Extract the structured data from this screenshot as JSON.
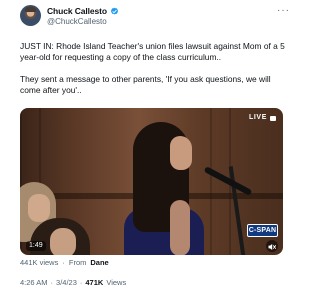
{
  "author": {
    "display_name": "Chuck Callesto",
    "handle": "@ChuckCallesto",
    "verified": true,
    "avatar_icon": "profile-photo"
  },
  "tweet": {
    "paragraphs": [
      "JUST IN: Rhode Island Teacher's union files lawsuit against Mom of a 5 year-old for requesting a copy of the class curriculum..",
      "They sent a message to other parents, 'If you ask questions, we will come after you'.."
    ]
  },
  "video": {
    "live_label": "LIVE",
    "network_label": "C-SPAN",
    "timestamp": "1:49",
    "mute_icon": "speaker-muted-icon"
  },
  "video_stats": {
    "views": "441K views",
    "separator": "·",
    "from_label": "From",
    "from_name": "Dane"
  },
  "meta": {
    "time": "4:26 AM",
    "separator": "·",
    "date": "3/4/23",
    "separator2": "·",
    "views_count": "471K",
    "views_label": "Views"
  },
  "colors": {
    "text_primary": "#0f1419",
    "text_secondary": "#536471",
    "verified_blue": "#1d9bf0",
    "cspan_blue": "#123a80"
  }
}
